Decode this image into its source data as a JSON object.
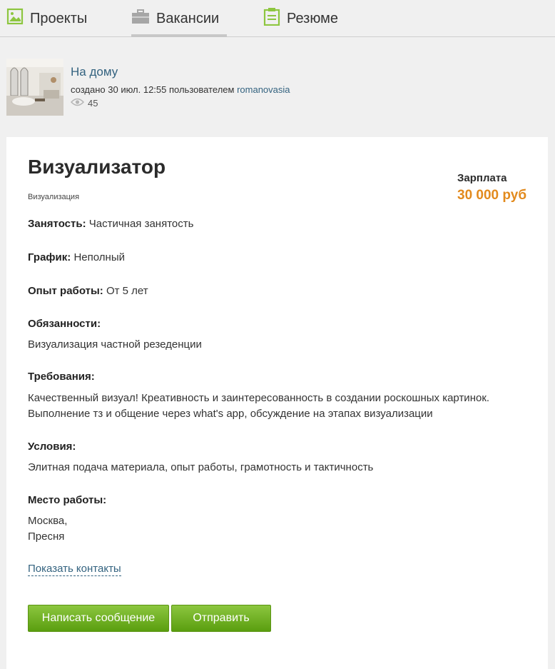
{
  "nav": {
    "projects_label": "Проекты",
    "vacancies_label": "Вакансии",
    "resume_label": "Резюме",
    "active_tab": "Вакансии",
    "icon_color": "#8dc63f"
  },
  "project": {
    "title": "На дому",
    "meta_prefix": "создано 30 июл. 12:55 пользователем",
    "username": "romanovasia",
    "views": "45"
  },
  "job": {
    "title": "Визуализатор",
    "category": "Визуализация",
    "salary_label": "Зарплата",
    "salary_value": "30 000 руб",
    "employment_label": "Занятость:",
    "employment_value": "Частичная занятость",
    "schedule_label": "График:",
    "schedule_value": "Неполный",
    "experience_label": "Опыт работы:",
    "experience_value": "От 5 лет",
    "duties_label": "Обязанности:",
    "duties_text": "Визуализация частной резеденции",
    "requirements_label": "Требования:",
    "requirements_line1": "Качественный визуал! Креативность и заинтересованность в создании роскошных картинок.",
    "requirements_line2": "Выполнение тз и общение через what's app, обсуждение на этапах визуализации",
    "conditions_label": "Условия:",
    "conditions_text": "Элитная подача материала, опыт работы, грамотность и тактичность",
    "location_label": "Место работы:",
    "location_line1": "Москва,",
    "location_line2": "Пресня"
  },
  "actions": {
    "show_contacts": "Показать контакты",
    "write_message": "Написать сообщение",
    "send": "Отправить"
  },
  "colors": {
    "link": "#33627f",
    "salary": "#e28a1d",
    "button": "#6fb01f"
  }
}
